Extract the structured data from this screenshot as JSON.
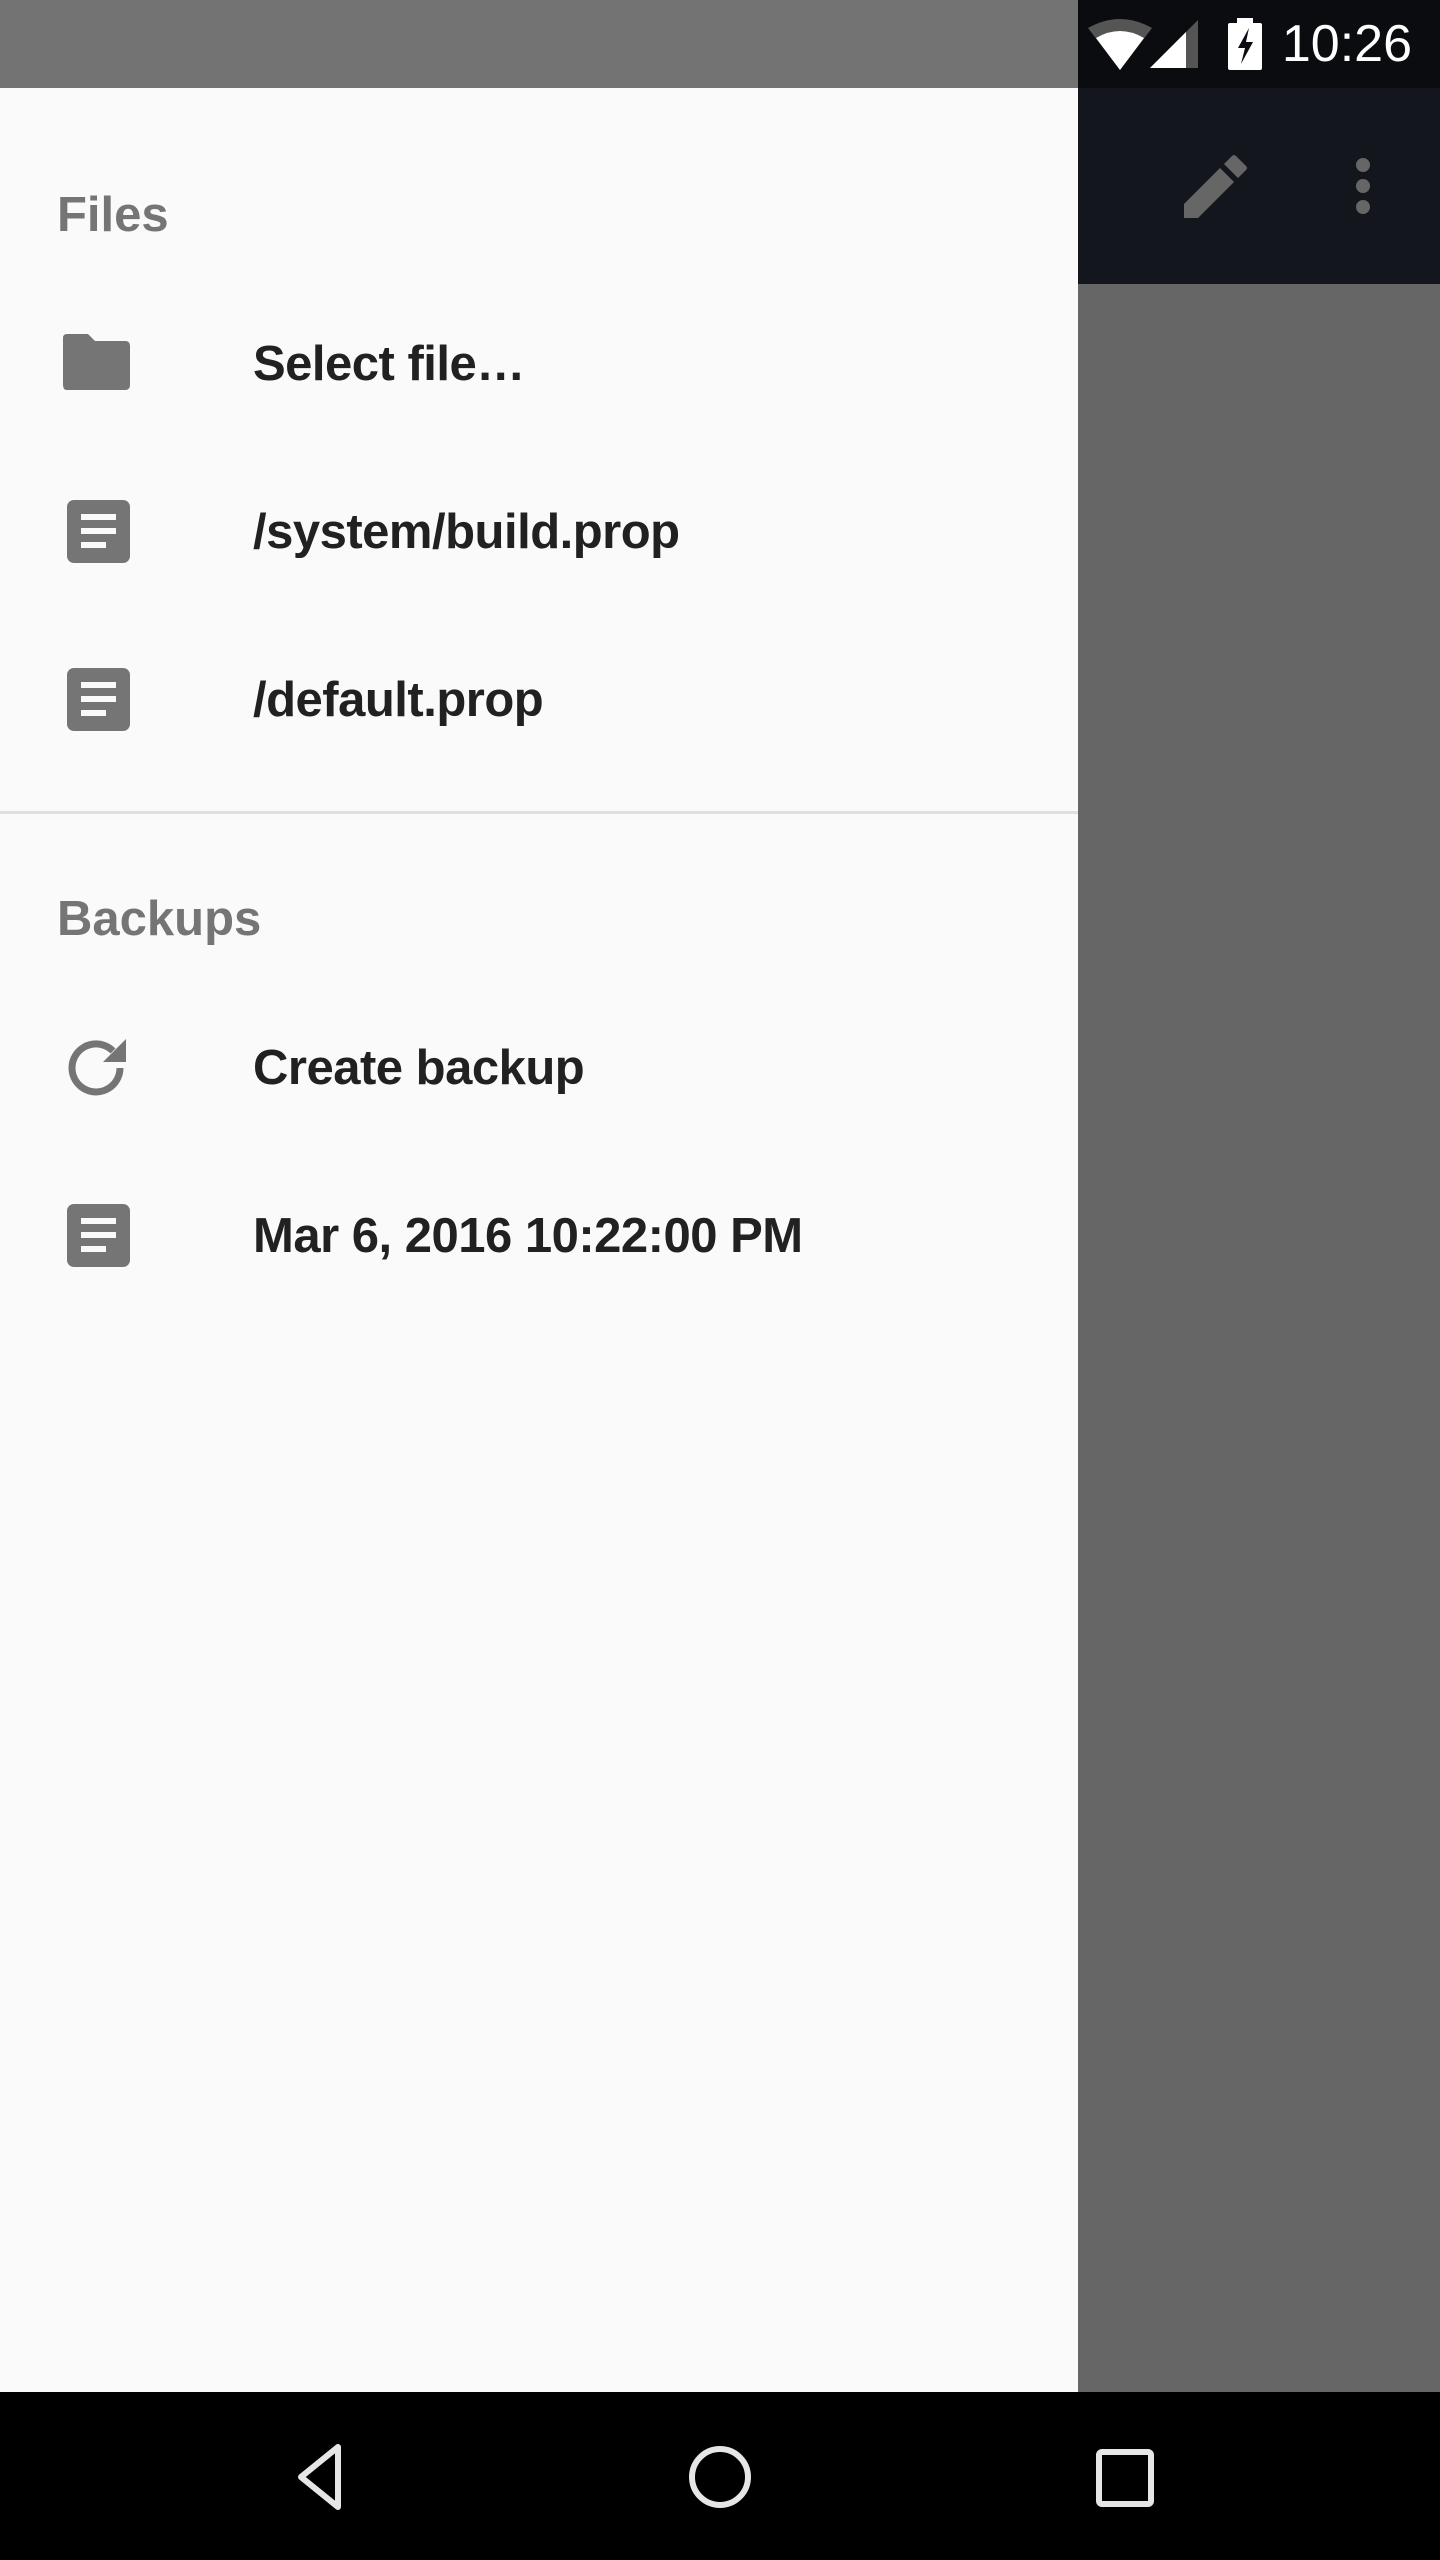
{
  "status_bar": {
    "time": "10:26",
    "icons": [
      "wifi-icon",
      "cell-signal-icon",
      "battery-charging-icon"
    ]
  },
  "toolbar": {
    "actions": [
      {
        "name": "edit",
        "icon": "pencil-icon"
      },
      {
        "name": "more-options",
        "icon": "more-vert-icon"
      }
    ]
  },
  "drawer": {
    "sections": [
      {
        "header": "Files",
        "items": [
          {
            "label": "Select file…",
            "icon": "folder-icon"
          },
          {
            "label": "/system/build.prop",
            "icon": "document-icon"
          },
          {
            "label": "/default.prop",
            "icon": "document-icon"
          }
        ]
      },
      {
        "header": "Backups",
        "items": [
          {
            "label": "Create backup",
            "icon": "refresh-icon"
          },
          {
            "label": "Mar 6, 2016 10:22:00 PM",
            "icon": "document-icon"
          }
        ]
      }
    ]
  },
  "nav_bar": {
    "buttons": [
      {
        "name": "back",
        "icon": "back-triangle-icon"
      },
      {
        "name": "home",
        "icon": "home-circle-icon"
      },
      {
        "name": "recents",
        "icon": "recents-square-icon"
      }
    ]
  },
  "colors": {
    "drawer_bg": "#fafafa",
    "section_header": "#757575",
    "item_text": "#212121",
    "icon": "#757575",
    "toolbar_bg": "#13161c",
    "scrim": "#666666"
  }
}
